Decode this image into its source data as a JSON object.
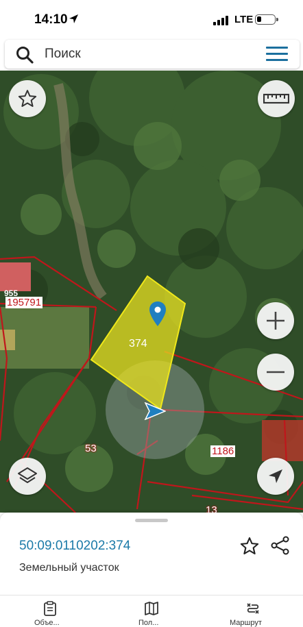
{
  "status_bar": {
    "time": "14:10",
    "network": "LTE"
  },
  "search": {
    "placeholder": "Поиск"
  },
  "map": {
    "labels": {
      "parcel_195791": "195791",
      "parcel_955": "955",
      "parcel_374": "374",
      "parcel_53": "53",
      "parcel_1186": "1186",
      "parcel_13": "13"
    },
    "colors": {
      "selected_fill": "#e8e020",
      "boundary": "#c0161b",
      "marker": "#1f7fc0"
    },
    "controls": [
      "star-icon",
      "ruler-icon",
      "zoom-in-icon",
      "zoom-out-icon",
      "layers-icon",
      "navigation-arrow-icon"
    ]
  },
  "card": {
    "cadastral_number": "50:09:0110202:374",
    "object_type": "Земельный участок"
  },
  "nav": {
    "items": [
      {
        "icon": "clipboard-icon",
        "label": "Объе..."
      },
      {
        "icon": "map-icon",
        "label": "Пол..."
      },
      {
        "icon": "route-icon",
        "label": "Маршрут"
      }
    ]
  }
}
